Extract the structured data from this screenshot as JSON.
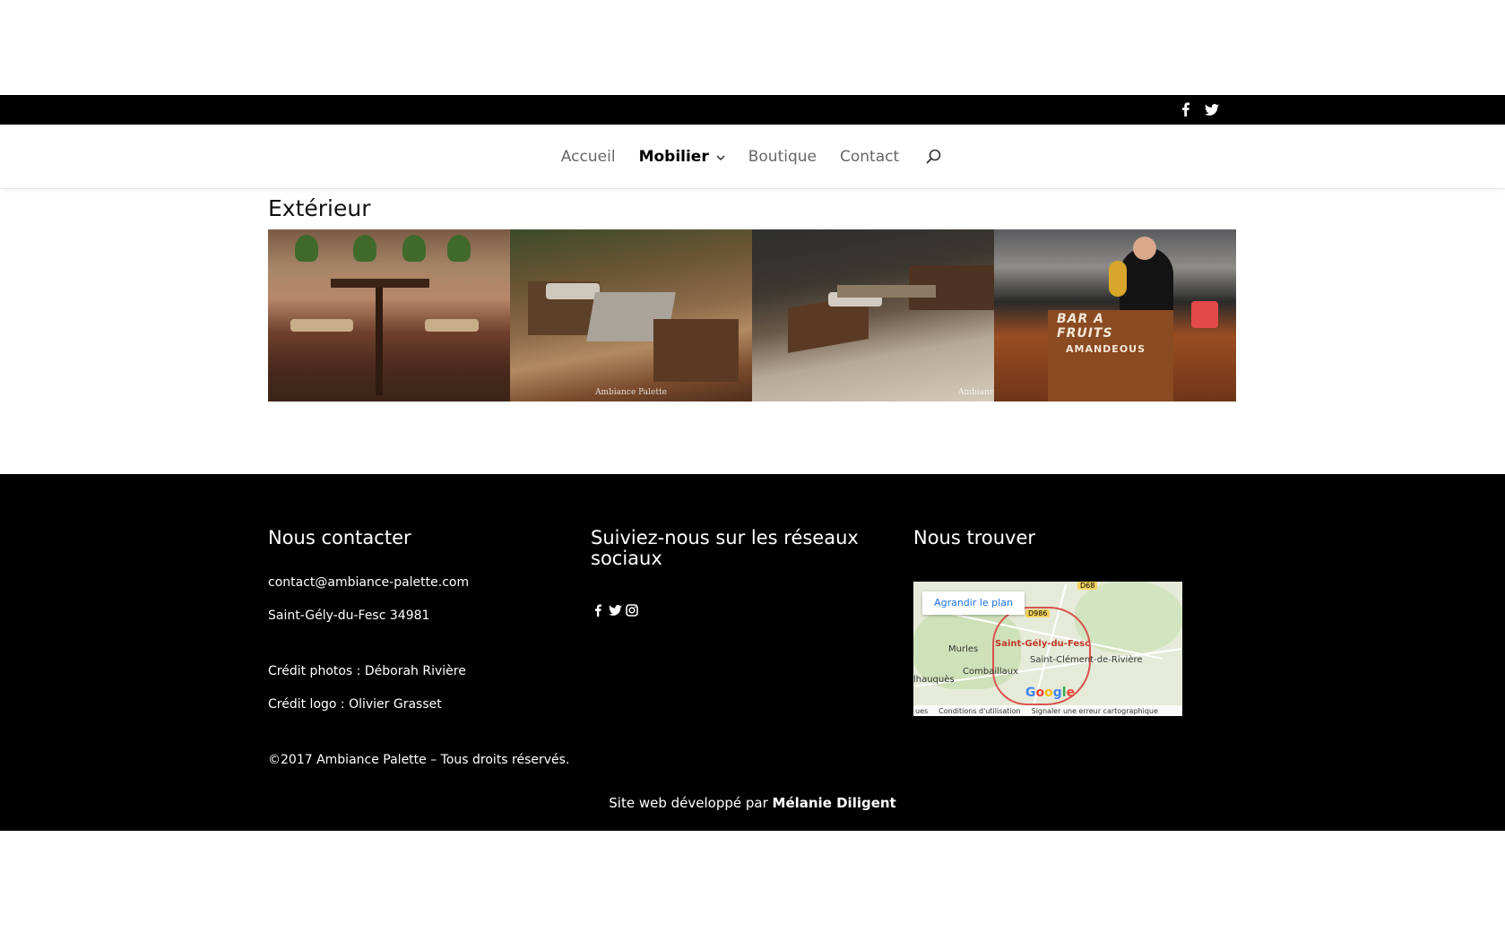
{
  "topbar": {
    "social_icons": [
      "facebook-icon",
      "twitter-icon"
    ]
  },
  "nav": {
    "items": [
      {
        "label": "Accueil"
      },
      {
        "label": "Mobilier"
      },
      {
        "label": "Boutique"
      },
      {
        "label": "Contact"
      }
    ],
    "active": "Mobilier",
    "search_icon": "search-icon"
  },
  "main": {
    "title": "Extérieur",
    "gallery": [
      {
        "watermark": ""
      },
      {
        "watermark": "Ambiance Palette"
      },
      {
        "watermark": "Ambiance"
      },
      {
        "sign1": "BAR A FRUITS",
        "sign2": "AMANDEOUS"
      }
    ]
  },
  "footer": {
    "contact": {
      "heading": "Nous contacter",
      "email": "contact@ambiance-palette.com",
      "city": "Saint-Gély-du-Fesc 34981",
      "photo_credit": "Crédit photos : Déborah Rivière",
      "logo_credit": "Crédit logo : Olivier Grasset",
      "copyright": "©2017 Ambiance Palette – Tous droits réservés."
    },
    "social": {
      "heading": "Suiviez-nous sur les réseaux sociaux",
      "icons": [
        "facebook-icon",
        "twitter-icon",
        "instagram-icon"
      ]
    },
    "map": {
      "heading": "Nous trouver",
      "button": "Agrandir le plan",
      "places": [
        "Saint-Gély-du-Fesc",
        "Saint-Clément-de-Rivière",
        "Murles",
        "Combaillaux",
        "lhauquès"
      ],
      "roads": [
        "D68",
        "D986"
      ],
      "google": "Google",
      "bottom_links": [
        "ues",
        "Conditions d'utilisation",
        "Signaler une erreur cartographique"
      ]
    },
    "credit_prefix": "Site web développé par ",
    "credit_name": "Mélanie Diligent"
  },
  "colors": {
    "topbar_bg": "#000000",
    "footer_bg": "#000000",
    "nav_text": "#666666",
    "nav_active": "#000000",
    "map_button_text": "#1a73e8"
  }
}
